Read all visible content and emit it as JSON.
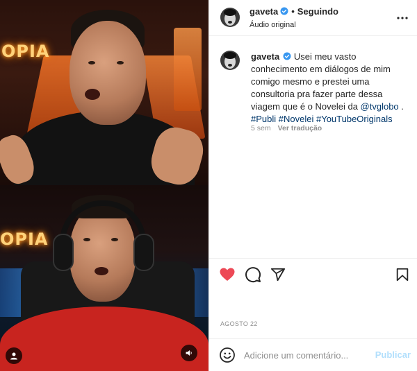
{
  "post": {
    "username": "gaveta",
    "follow_state": "Seguindo",
    "audio_label": "Áudio original",
    "caption": {
      "username": "gaveta",
      "text_part1": "Usei meu vasto conhecimento em diálogos de mim comigo mesmo e prestei uma consultoria pra fazer parte dessa viagem que é o Novelei da ",
      "mention": "@tvglobo",
      "text_part2": " .",
      "hashtags": [
        "#Publi",
        "#Novelei",
        "#YouTubeOriginals"
      ],
      "age": "5 sem",
      "translate_label": "Ver tradução"
    },
    "date": "AGOSTO 22",
    "liked": true
  },
  "media": {
    "sign_text_top": "OPIA",
    "sign_text_bottom": "OPIA"
  },
  "comment_box": {
    "placeholder": "Adicione um comentário...",
    "publish_label": "Publicar"
  },
  "icons": {
    "verified": "verified-badge-icon",
    "more": "more-options-icon",
    "like": "heart-icon",
    "comment": "comment-icon",
    "share": "share-icon",
    "save": "bookmark-icon",
    "emoji": "emoji-icon",
    "user_tag": "user-tag-icon",
    "audio": "speaker-icon"
  },
  "colors": {
    "like_red": "#ed4956",
    "verified_blue": "#3897f0",
    "link_blue": "#00376b",
    "publish_disabled": "#b2dffc"
  }
}
